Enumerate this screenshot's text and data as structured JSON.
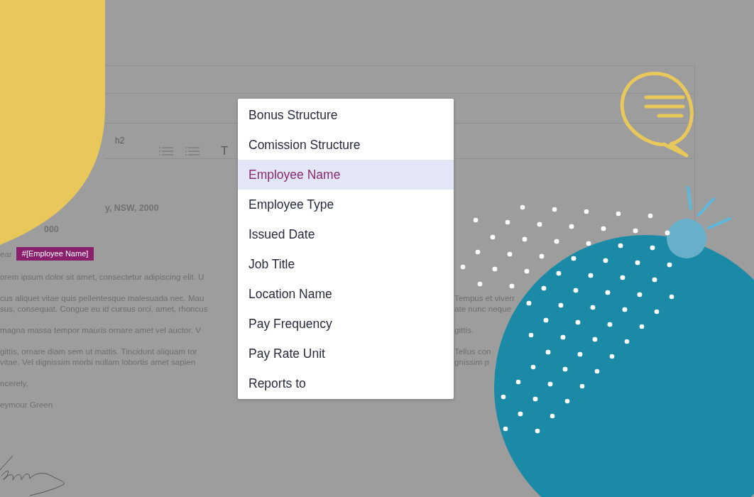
{
  "document": {
    "toolbar": {
      "heading_button": "h2",
      "text_button": "T"
    },
    "address_lines": [
      "y, NSW, 2000",
      "000"
    ],
    "greeting": {
      "text": "ear",
      "tag": "#[Employee Name]"
    },
    "paragraphs": [
      {
        "lines": [
          {
            "left": "orem ipsum dolor sit amet, consectetur adipiscing elit. U"
          }
        ]
      },
      {
        "lines": [
          {
            "left": "cus aliquet vitae quis pellentesque malesuada nec. Mau",
            "right": "Tempus et viverr"
          },
          {
            "left": "sus, consequat. Congue eu id cursus orci, amet, rhoncus",
            "right": "ate nunc neque"
          }
        ]
      },
      {
        "lines": [
          {
            "left": "magna massa tempor mauris ornare amet vel auctor. V",
            "right": "gittis."
          }
        ]
      },
      {
        "lines": [
          {
            "left": "gittis, ornare diam sem ut mattis. Tincidunt aliquam tor",
            "right": "Tellus con"
          },
          {
            "left": "vitae. Vel dignissim morbi nullam lobortis amet sapien",
            "right": "gnissim p"
          }
        ]
      }
    ],
    "closing": "ncerely,",
    "signature_name": "eymour Green"
  },
  "menu": {
    "items": [
      {
        "label": "Bonus Structure",
        "selected": false
      },
      {
        "label": "Comission Structure",
        "selected": false
      },
      {
        "label": "Employee Name",
        "selected": true
      },
      {
        "label": "Employee Type",
        "selected": false
      },
      {
        "label": "Issued Date",
        "selected": false
      },
      {
        "label": "Job Title",
        "selected": false
      },
      {
        "label": "Location Name",
        "selected": false
      },
      {
        "label": "Pay Frequency",
        "selected": false
      },
      {
        "label": "Pay Rate Unit",
        "selected": false
      },
      {
        "label": "Reports to",
        "selected": false
      }
    ]
  }
}
